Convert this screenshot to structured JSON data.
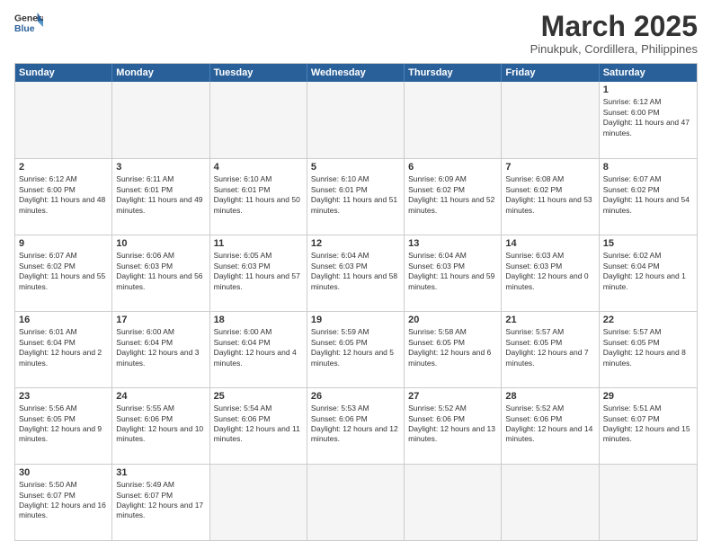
{
  "logo": {
    "text_general": "General",
    "text_blue": "Blue"
  },
  "header": {
    "month_title": "March 2025",
    "location": "Pinukpuk, Cordillera, Philippines"
  },
  "weekdays": [
    "Sunday",
    "Monday",
    "Tuesday",
    "Wednesday",
    "Thursday",
    "Friday",
    "Saturday"
  ],
  "weeks": [
    [
      {
        "day": "",
        "empty": true
      },
      {
        "day": "",
        "empty": true
      },
      {
        "day": "",
        "empty": true
      },
      {
        "day": "",
        "empty": true
      },
      {
        "day": "",
        "empty": true
      },
      {
        "day": "",
        "empty": true
      },
      {
        "day": "1",
        "sunrise": "6:12 AM",
        "sunset": "6:00 PM",
        "daylight": "11 hours and 47 minutes."
      }
    ],
    [
      {
        "day": "2",
        "sunrise": "6:12 AM",
        "sunset": "6:00 PM",
        "daylight": "11 hours and 48 minutes."
      },
      {
        "day": "3",
        "sunrise": "6:11 AM",
        "sunset": "6:01 PM",
        "daylight": "11 hours and 49 minutes."
      },
      {
        "day": "4",
        "sunrise": "6:10 AM",
        "sunset": "6:01 PM",
        "daylight": "11 hours and 50 minutes."
      },
      {
        "day": "5",
        "sunrise": "6:10 AM",
        "sunset": "6:01 PM",
        "daylight": "11 hours and 51 minutes."
      },
      {
        "day": "6",
        "sunrise": "6:09 AM",
        "sunset": "6:02 PM",
        "daylight": "11 hours and 52 minutes."
      },
      {
        "day": "7",
        "sunrise": "6:08 AM",
        "sunset": "6:02 PM",
        "daylight": "11 hours and 53 minutes."
      },
      {
        "day": "8",
        "sunrise": "6:07 AM",
        "sunset": "6:02 PM",
        "daylight": "11 hours and 54 minutes."
      }
    ],
    [
      {
        "day": "9",
        "sunrise": "6:07 AM",
        "sunset": "6:02 PM",
        "daylight": "11 hours and 55 minutes."
      },
      {
        "day": "10",
        "sunrise": "6:06 AM",
        "sunset": "6:03 PM",
        "daylight": "11 hours and 56 minutes."
      },
      {
        "day": "11",
        "sunrise": "6:05 AM",
        "sunset": "6:03 PM",
        "daylight": "11 hours and 57 minutes."
      },
      {
        "day": "12",
        "sunrise": "6:04 AM",
        "sunset": "6:03 PM",
        "daylight": "11 hours and 58 minutes."
      },
      {
        "day": "13",
        "sunrise": "6:04 AM",
        "sunset": "6:03 PM",
        "daylight": "11 hours and 59 minutes."
      },
      {
        "day": "14",
        "sunrise": "6:03 AM",
        "sunset": "6:03 PM",
        "daylight": "12 hours and 0 minutes."
      },
      {
        "day": "15",
        "sunrise": "6:02 AM",
        "sunset": "6:04 PM",
        "daylight": "12 hours and 1 minute."
      }
    ],
    [
      {
        "day": "16",
        "sunrise": "6:01 AM",
        "sunset": "6:04 PM",
        "daylight": "12 hours and 2 minutes."
      },
      {
        "day": "17",
        "sunrise": "6:00 AM",
        "sunset": "6:04 PM",
        "daylight": "12 hours and 3 minutes."
      },
      {
        "day": "18",
        "sunrise": "6:00 AM",
        "sunset": "6:04 PM",
        "daylight": "12 hours and 4 minutes."
      },
      {
        "day": "19",
        "sunrise": "5:59 AM",
        "sunset": "6:05 PM",
        "daylight": "12 hours and 5 minutes."
      },
      {
        "day": "20",
        "sunrise": "5:58 AM",
        "sunset": "6:05 PM",
        "daylight": "12 hours and 6 minutes."
      },
      {
        "day": "21",
        "sunrise": "5:57 AM",
        "sunset": "6:05 PM",
        "daylight": "12 hours and 7 minutes."
      },
      {
        "day": "22",
        "sunrise": "5:57 AM",
        "sunset": "6:05 PM",
        "daylight": "12 hours and 8 minutes."
      }
    ],
    [
      {
        "day": "23",
        "sunrise": "5:56 AM",
        "sunset": "6:05 PM",
        "daylight": "12 hours and 9 minutes."
      },
      {
        "day": "24",
        "sunrise": "5:55 AM",
        "sunset": "6:06 PM",
        "daylight": "12 hours and 10 minutes."
      },
      {
        "day": "25",
        "sunrise": "5:54 AM",
        "sunset": "6:06 PM",
        "daylight": "12 hours and 11 minutes."
      },
      {
        "day": "26",
        "sunrise": "5:53 AM",
        "sunset": "6:06 PM",
        "daylight": "12 hours and 12 minutes."
      },
      {
        "day": "27",
        "sunrise": "5:52 AM",
        "sunset": "6:06 PM",
        "daylight": "12 hours and 13 minutes."
      },
      {
        "day": "28",
        "sunrise": "5:52 AM",
        "sunset": "6:06 PM",
        "daylight": "12 hours and 14 minutes."
      },
      {
        "day": "29",
        "sunrise": "5:51 AM",
        "sunset": "6:07 PM",
        "daylight": "12 hours and 15 minutes."
      }
    ],
    [
      {
        "day": "30",
        "sunrise": "5:50 AM",
        "sunset": "6:07 PM",
        "daylight": "12 hours and 16 minutes."
      },
      {
        "day": "31",
        "sunrise": "5:49 AM",
        "sunset": "6:07 PM",
        "daylight": "12 hours and 17 minutes."
      },
      {
        "day": "",
        "empty": true
      },
      {
        "day": "",
        "empty": true
      },
      {
        "day": "",
        "empty": true
      },
      {
        "day": "",
        "empty": true
      },
      {
        "day": "",
        "empty": true
      }
    ]
  ]
}
